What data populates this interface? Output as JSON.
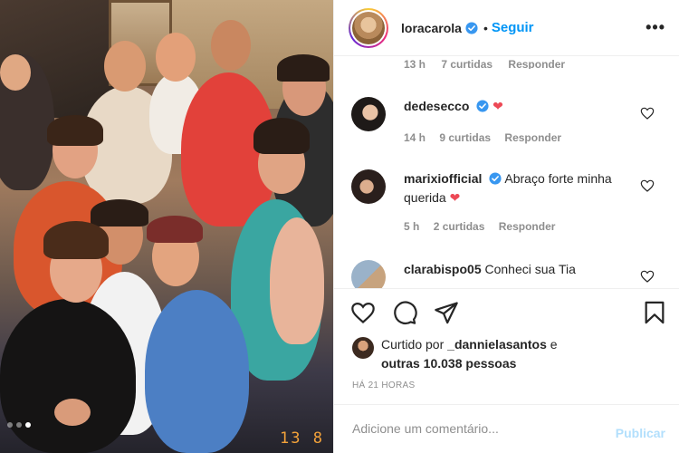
{
  "post_image": {
    "alt_visible_stamp": "13 8",
    "carousel_dots": 3,
    "active_dot": 3
  },
  "header": {
    "username": "loracarola",
    "separator": "•",
    "follow_label": "Seguir",
    "more_label": "•••"
  },
  "comments": {
    "cut_row": {
      "time": "13 h",
      "likes": "7 curtidas",
      "reply": "Responder"
    },
    "items": [
      {
        "username": "dedesecco",
        "text": "",
        "emoji": "❤",
        "time": "14 h",
        "likes": "9 curtidas",
        "reply": "Responder"
      },
      {
        "username": "marixiofficial",
        "text": "Abraço forte minha querida",
        "emoji": "❤",
        "time": "5 h",
        "likes": "2 curtidas",
        "reply": "Responder"
      },
      {
        "username": "clarabispo05",
        "text": "Conheci sua Tia",
        "emoji": "",
        "time": "",
        "likes": "",
        "reply": ""
      }
    ]
  },
  "likes": {
    "prefix": "Curtido por",
    "user": "_dannielasantos",
    "conjunction": "e",
    "others": "outras 10.038 pessoas"
  },
  "timestamp": "HÁ 21 HORAS",
  "add_comment": {
    "placeholder": "Adicione um comentário...",
    "publish_label": "Publicar"
  },
  "colors": {
    "accent": "#0095f6",
    "heart": "#ed4956",
    "muted": "#8e8e8e",
    "publish_disabled": "#b2dffc"
  }
}
